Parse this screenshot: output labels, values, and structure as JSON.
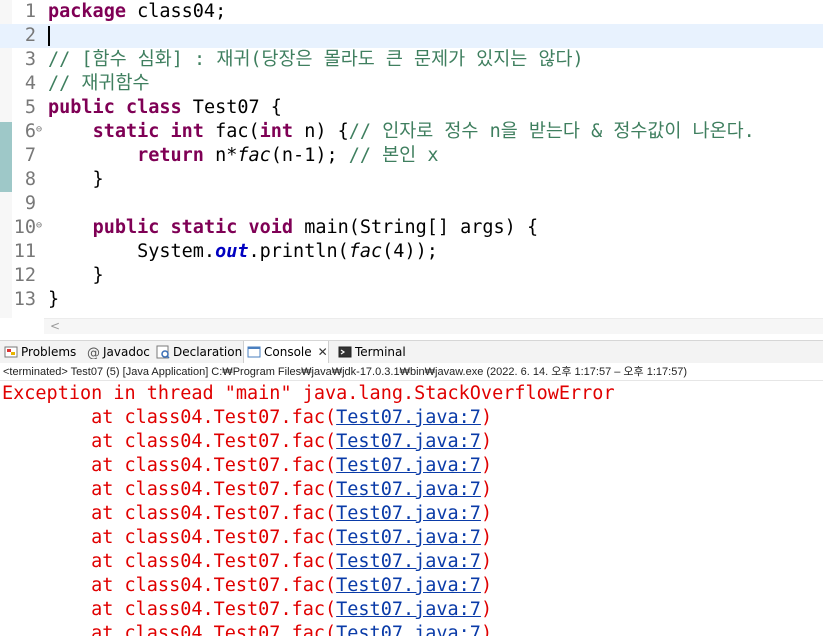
{
  "editor": {
    "lines": [
      {
        "num": "1",
        "tokens": [
          {
            "t": "package",
            "c": "kw"
          },
          {
            "t": " class04;",
            "c": ""
          }
        ]
      },
      {
        "num": "2",
        "tokens": []
      },
      {
        "num": "3",
        "tokens": [
          {
            "t": "// [함수 심화] : 재귀(당장은 몰라도 큰 문제가 있지는 않다)",
            "c": "cm"
          }
        ]
      },
      {
        "num": "4",
        "tokens": [
          {
            "t": "// 재귀함수",
            "c": "cm"
          }
        ]
      },
      {
        "num": "5",
        "tokens": [
          {
            "t": "public",
            "c": "kw"
          },
          {
            "t": " ",
            "c": ""
          },
          {
            "t": "class",
            "c": "kw"
          },
          {
            "t": " Test07 {",
            "c": ""
          }
        ]
      },
      {
        "num": "6",
        "fold": "⊖",
        "tokens": [
          {
            "t": "    ",
            "c": ""
          },
          {
            "t": "static",
            "c": "kw"
          },
          {
            "t": " ",
            "c": ""
          },
          {
            "t": "int",
            "c": "kw"
          },
          {
            "t": " fac(",
            "c": ""
          },
          {
            "t": "int",
            "c": "kw"
          },
          {
            "t": " n) {",
            "c": ""
          },
          {
            "t": "// 인자로 정수 n을 받는다 & 정수값이 나온다.",
            "c": "cm"
          }
        ]
      },
      {
        "num": "7",
        "tokens": [
          {
            "t": "        ",
            "c": ""
          },
          {
            "t": "return",
            "c": "kw"
          },
          {
            "t": " n*",
            "c": ""
          },
          {
            "t": "fac",
            "c": "st"
          },
          {
            "t": "(n-1); ",
            "c": ""
          },
          {
            "t": "// 본인 x",
            "c": "cm"
          }
        ]
      },
      {
        "num": "8",
        "tokens": [
          {
            "t": "    }",
            "c": ""
          }
        ]
      },
      {
        "num": "9",
        "tokens": []
      },
      {
        "num": "10",
        "fold": "⊖",
        "tokens": [
          {
            "t": "    ",
            "c": ""
          },
          {
            "t": "public",
            "c": "kw"
          },
          {
            "t": " ",
            "c": ""
          },
          {
            "t": "static",
            "c": "kw"
          },
          {
            "t": " ",
            "c": ""
          },
          {
            "t": "void",
            "c": "kw"
          },
          {
            "t": " main(String[] args) {",
            "c": ""
          }
        ]
      },
      {
        "num": "11",
        "tokens": [
          {
            "t": "        System.",
            "c": ""
          },
          {
            "t": "out",
            "c": "fld"
          },
          {
            "t": ".println(",
            "c": ""
          },
          {
            "t": "fac",
            "c": "st"
          },
          {
            "t": "(4));",
            "c": ""
          }
        ]
      },
      {
        "num": "12",
        "tokens": [
          {
            "t": "    }",
            "c": ""
          }
        ]
      },
      {
        "num": "13",
        "tokens": [
          {
            "t": "}",
            "c": ""
          }
        ]
      }
    ],
    "current_line_index": 1
  },
  "views": {
    "tabs": [
      {
        "label": "Problems",
        "icon": "problems-icon"
      },
      {
        "label": "Javadoc",
        "icon": "javadoc-icon"
      },
      {
        "label": "Declaration",
        "icon": "declaration-icon"
      },
      {
        "label": "Console",
        "icon": "console-icon",
        "active": true,
        "close": "✕"
      },
      {
        "label": "Terminal",
        "icon": "terminal-icon"
      }
    ],
    "status": "<terminated> Test07 (5) [Java Application] C:₩Program Files₩java₩jdk-17.0.3.1₩bin₩javaw.exe  (2022. 6. 14. 오후 1:17:57 – 오후 1:17:57)"
  },
  "console": {
    "header": "Exception in thread \"main\" java.lang.StackOverflowError",
    "frame_prefix": "        at class04.Test07.fac(",
    "frame_link": "Test07.java:7",
    "frame_suffix": ")",
    "frame_count": 10
  },
  "colors": {
    "keyword": "#7f0055",
    "comment": "#3f7f5f",
    "error": "#e00000",
    "link": "#0a3ba8",
    "current_line": "#e8f2fe"
  }
}
